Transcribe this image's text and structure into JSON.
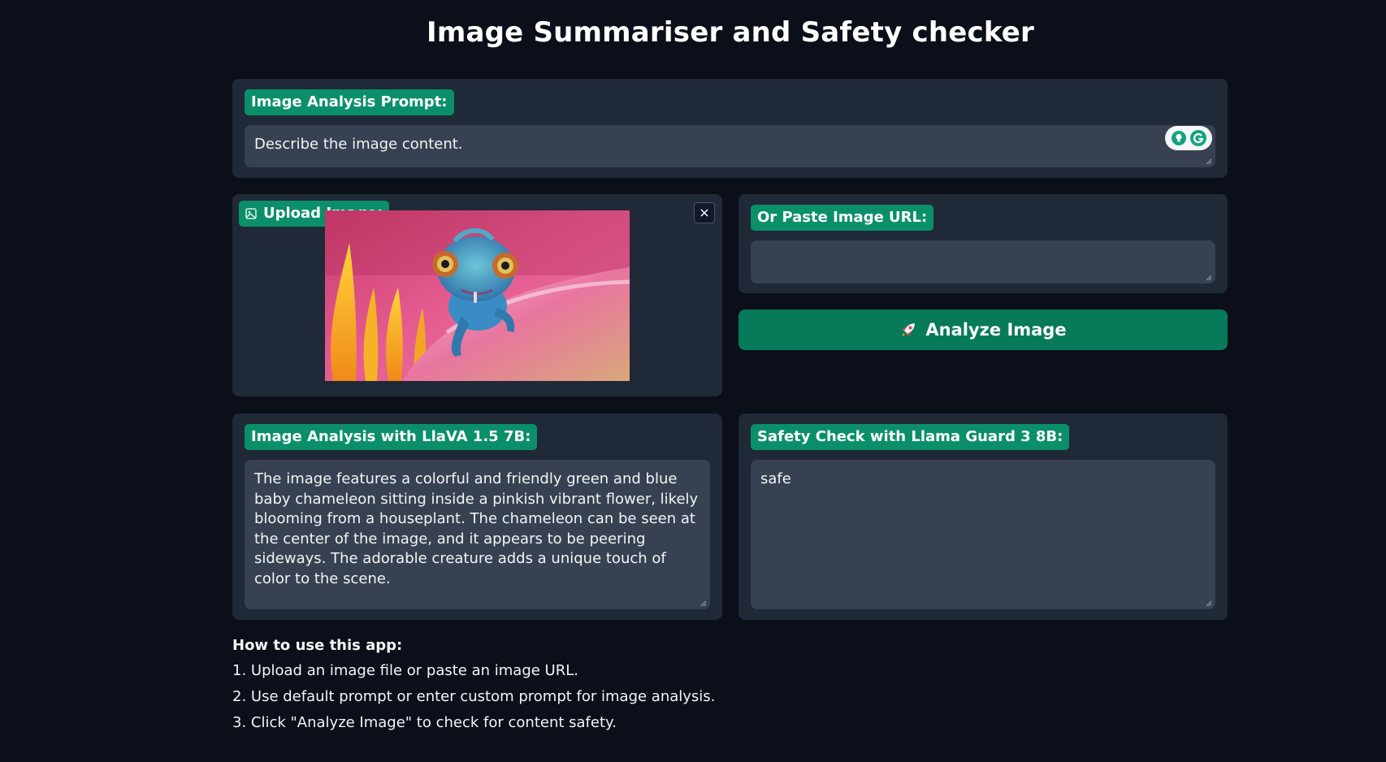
{
  "app": {
    "title": "Image Summariser and Safety checker"
  },
  "prompt": {
    "label": "Image Analysis Prompt:",
    "value": "Describe the image content."
  },
  "upload": {
    "label": "Upload Image:",
    "image_description_icon": "image-icon",
    "clear_icon": "close-icon"
  },
  "url_input": {
    "label": "Or Paste Image URL:",
    "value": ""
  },
  "analyze_button": {
    "icon": "rocket-icon",
    "label": "Analyze Image"
  },
  "analysis": {
    "label": "Image Analysis with LlaVA 1.5 7B:",
    "text": "The image features a colorful and friendly green and blue baby chameleon sitting inside a pinkish vibrant flower, likely blooming from a houseplant. The chameleon can be seen at the center of the image, and it appears to be peering sideways. The adorable creature adds a unique touch of color to the scene."
  },
  "safety": {
    "label": "Safety Check with Llama Guard 3 8B:",
    "text": "safe"
  },
  "howto": {
    "heading": "How to use this app:",
    "steps": [
      "1. Upload an image file or paste an image URL.",
      "2. Use default prompt or enter custom prompt for image analysis.",
      "3. Click \"Analyze Image\" to check for content safety."
    ]
  },
  "colors": {
    "background": "#0b0f19",
    "panel": "#1f2937",
    "field": "#374151",
    "accent": "#0b8f6a",
    "button": "#067a59"
  }
}
